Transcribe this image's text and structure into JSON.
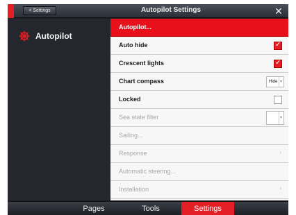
{
  "titlebar": {
    "back_label": "< Settings",
    "title": "Autopilot Settings",
    "close_icon": "close-icon"
  },
  "sidebar": {
    "item_label": "Autopilot",
    "item_icon": "autopilot-wheel-icon",
    "accent": "#e31e24"
  },
  "menu": {
    "header": "Autopilot...",
    "rows": [
      {
        "label": "Auto hide",
        "control": "checkbox",
        "checked": true
      },
      {
        "label": "Crescent lights",
        "control": "checkbox",
        "checked": true
      },
      {
        "label": "Chart compass",
        "control": "select",
        "value": "Hide"
      },
      {
        "label": "Locked",
        "control": "checkbox",
        "checked": false
      },
      {
        "label": "Sea state filter",
        "control": "select",
        "value": ""
      },
      {
        "label": "Sailing...",
        "control": "none"
      },
      {
        "label": "Response",
        "control": "chevron"
      },
      {
        "label": "Automatic steering...",
        "control": "none"
      },
      {
        "label": "Installation",
        "control": "chevron"
      }
    ]
  },
  "tabs": [
    {
      "label": "Pages",
      "active": false
    },
    {
      "label": "Tools",
      "active": false
    },
    {
      "label": "Settings",
      "active": true
    }
  ]
}
